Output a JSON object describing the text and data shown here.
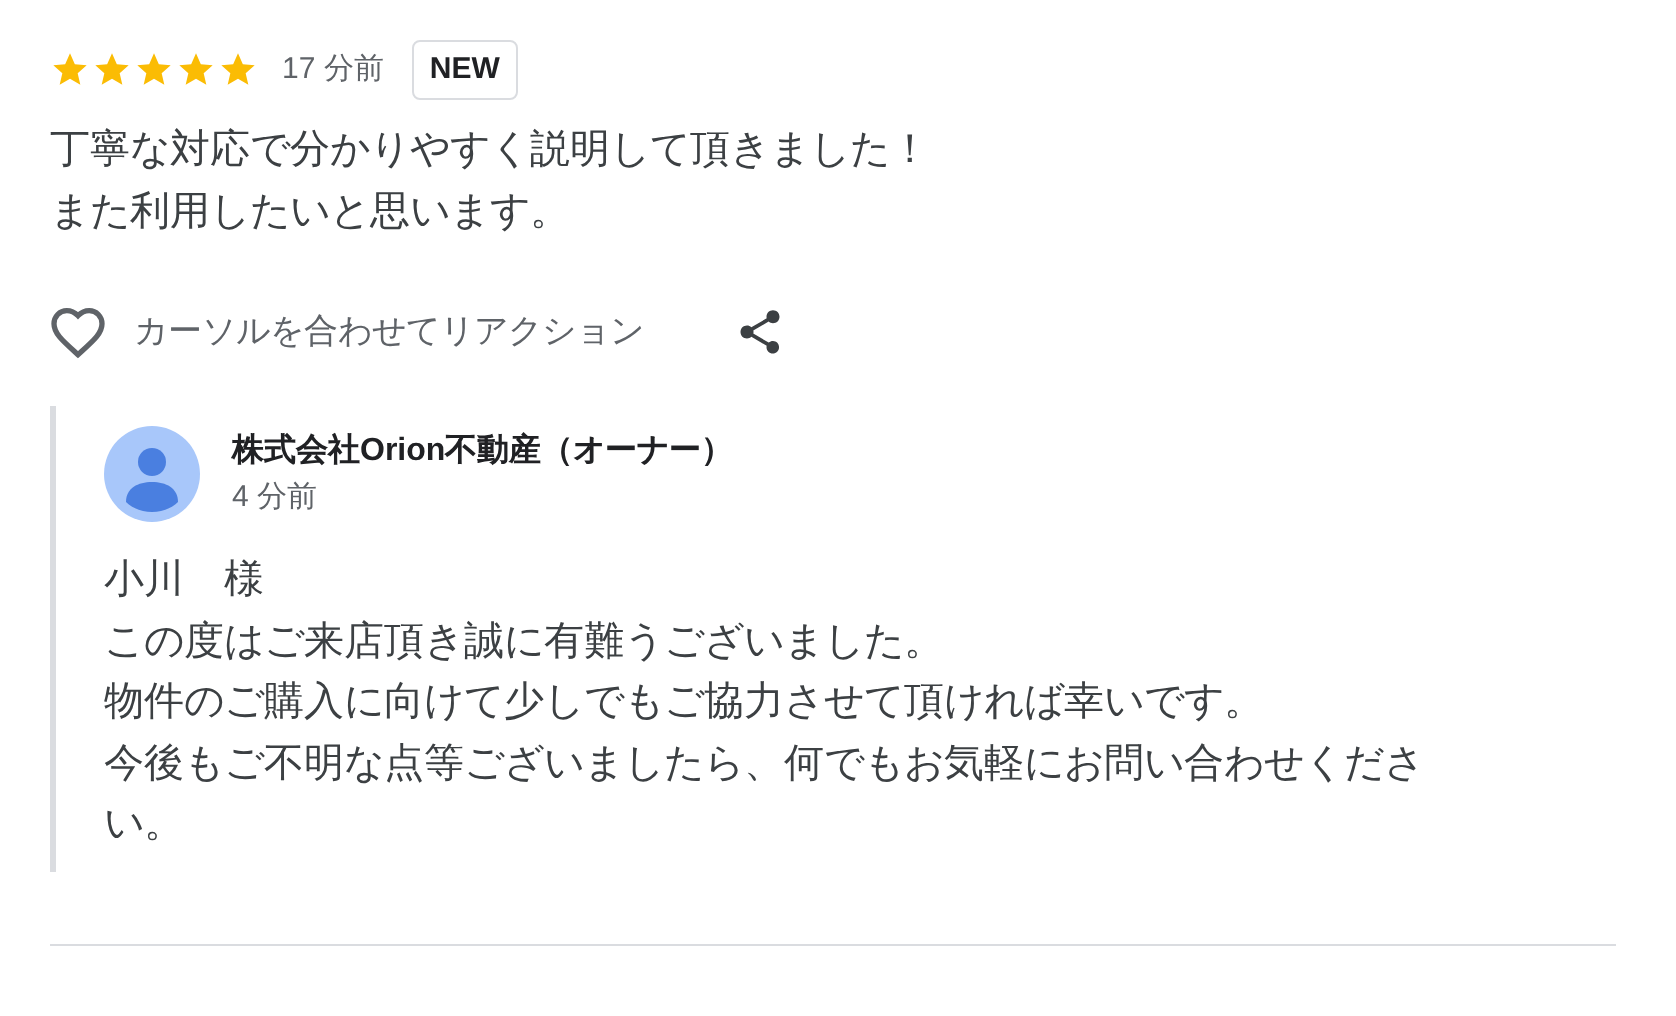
{
  "review": {
    "stars": 5,
    "time": "17 分前",
    "badge": "NEW",
    "text_lines": [
      "丁寧な対応で分かりやすく説明して頂きました！",
      "また利用したいと思います。"
    ],
    "reaction_label": "カーソルを合わせてリアクション"
  },
  "owner_reply": {
    "name": "株式会社Orion不動産（オーナー）",
    "time": "4 分前",
    "text_lines": [
      "小川　様",
      "この度はご来店頂き誠に有難うございました。",
      "物件のご購入に向けて少しでもご協力させて頂ければ幸いです。",
      "今後もご不明な点等ございましたら、何でもお気軽にお問い合わせください。"
    ]
  }
}
